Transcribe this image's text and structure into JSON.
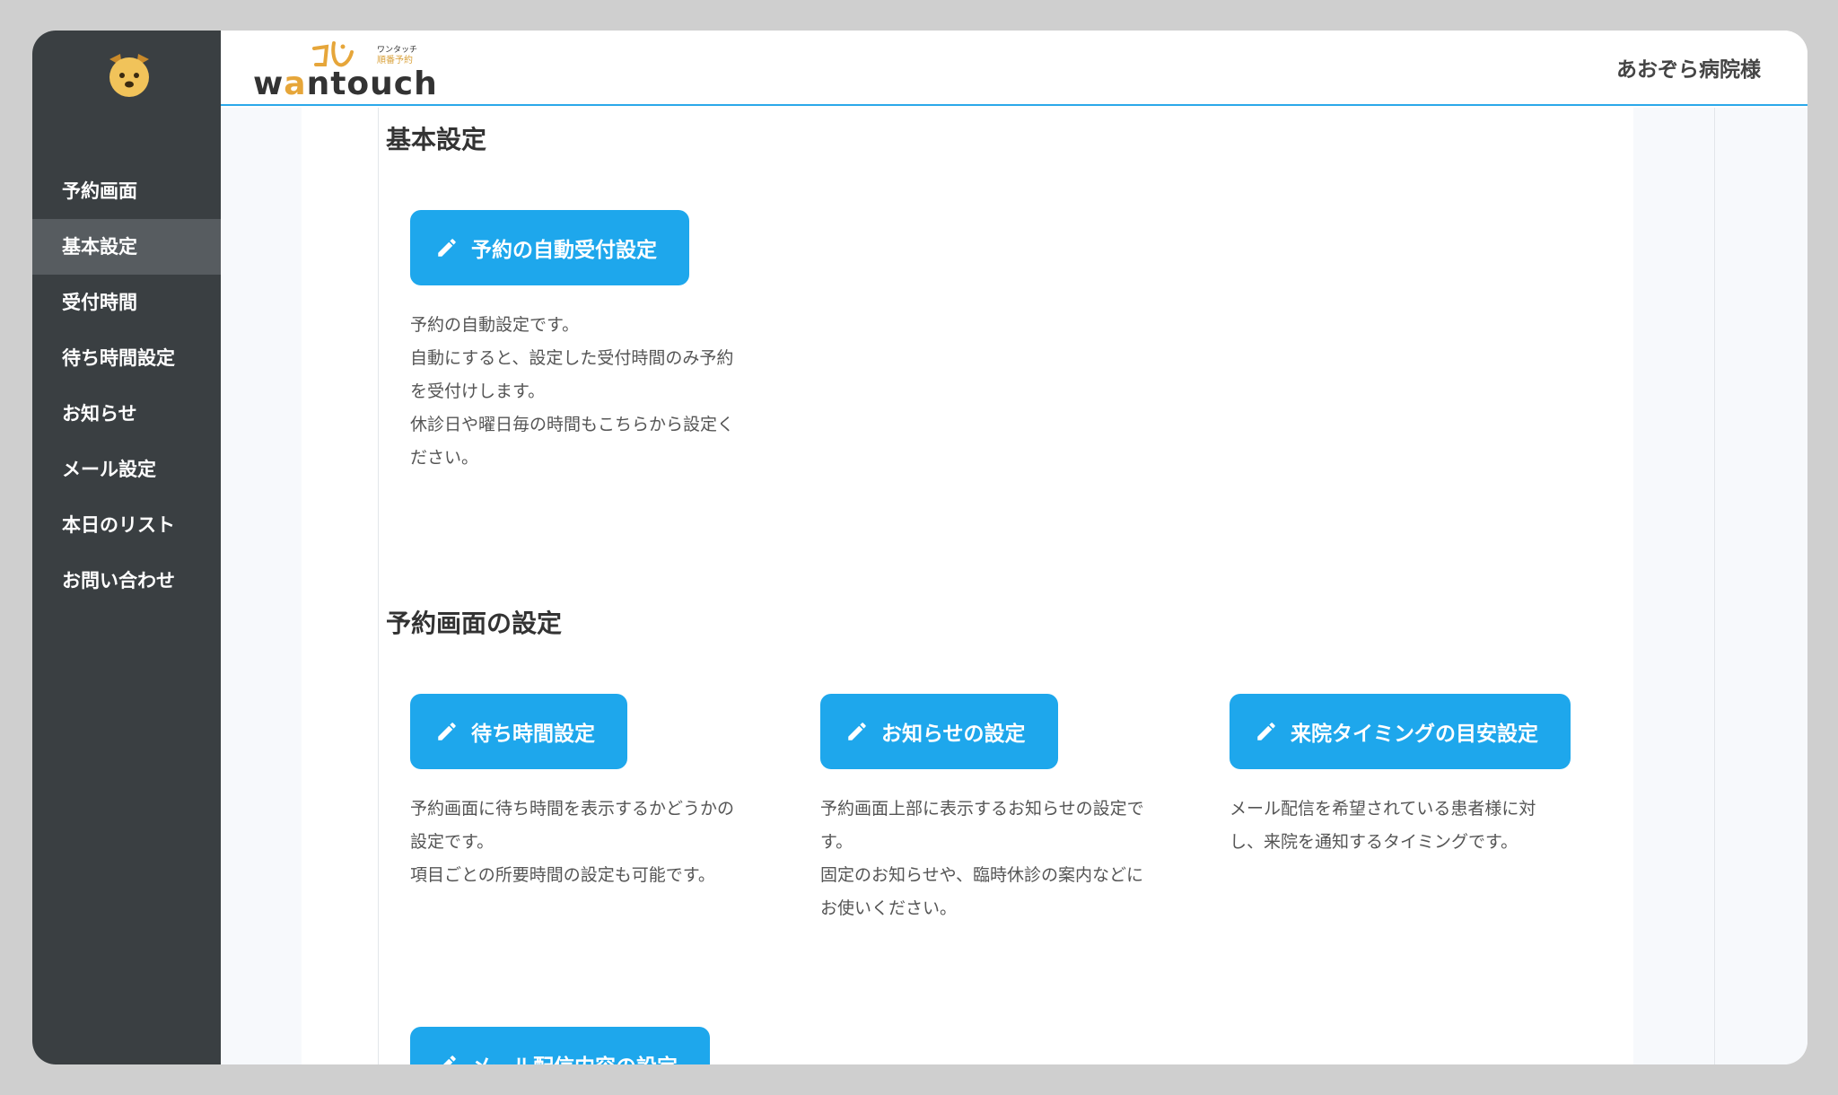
{
  "sidebar": {
    "items": [
      {
        "label": "予約画面"
      },
      {
        "label": "基本設定"
      },
      {
        "label": "受付時間"
      },
      {
        "label": "待ち時間設定"
      },
      {
        "label": "お知らせ"
      },
      {
        "label": "メール設定"
      },
      {
        "label": "本日のリスト"
      },
      {
        "label": "お問い合わせ"
      }
    ],
    "active_index": 1
  },
  "header": {
    "brand": {
      "word_prefix": "w",
      "word_accent": "a",
      "word_suffix": "ntouch",
      "tag_line1": "ワンタッチ",
      "tag_line2": "順番予約"
    },
    "hospital": "あおぞら病院様"
  },
  "sections": {
    "basic": {
      "title": "基本設定",
      "button": "予約の自動受付設定",
      "desc": [
        "予約の自動設定です。",
        "自動にすると、設定した受付時間のみ予約",
        "を受付けします。",
        "休診日や曜日毎の時間もこちらから設定く",
        "ださい。"
      ]
    },
    "reservation": {
      "title": "予約画面の設定",
      "cards": [
        {
          "button": "待ち時間設定",
          "desc": [
            "予約画面に待ち時間を表示するかどうかの",
            "設定です。",
            "項目ごとの所要時間の設定も可能です。"
          ]
        },
        {
          "button": "お知らせの設定",
          "desc": [
            "予約画面上部に表示するお知らせの設定で",
            "す。",
            "固定のお知らせや、臨時休診の案内などに",
            "お使いください。"
          ]
        },
        {
          "button": "来院タイミングの目安設定",
          "desc": [
            "メール配信を希望されている患者様に対",
            "し、来院を通知するタイミングです。"
          ]
        }
      ],
      "partial_button": "メール配信内容の設定"
    }
  },
  "colors": {
    "sidebar_bg": "#3a3f42",
    "sidebar_active": "#575c60",
    "accent_blue": "#1ea7ec",
    "brand_gold": "#e6a63a"
  },
  "icons": {
    "logo": "dog-face-icon",
    "button": "pencil-icon"
  }
}
